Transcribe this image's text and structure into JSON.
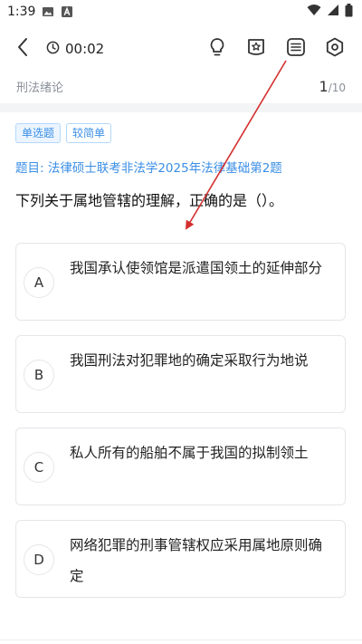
{
  "status_bar": {
    "time": "1:39",
    "icons": [
      "image-icon",
      "a-icon",
      "wifi-icon",
      "signal-icon",
      "battery-icon"
    ]
  },
  "header": {
    "timer": "00:02",
    "icons": [
      "back-arrow-icon",
      "clock-icon",
      "lightbulb-icon",
      "star-badge-icon",
      "list-icon",
      "settings-hexagon-icon"
    ]
  },
  "sub_bar": {
    "chapter": "刑法绪论",
    "current": "1",
    "total": "/10"
  },
  "question": {
    "tags": [
      "单选题",
      "较简单"
    ],
    "source": "题目: 法律硕士联考非法学2025年法律基础第2题",
    "text": "下列关于属地管辖的理解，正确的是（）。",
    "options": [
      {
        "letter": "A",
        "text": "我国承认使领馆是派遣国领土的延伸部分"
      },
      {
        "letter": "B",
        "text": "我国刑法对犯罪地的确定采取行为地说"
      },
      {
        "letter": "C",
        "text": "私人所有的船舶不属于我国的拟制领土"
      },
      {
        "letter": "D",
        "text": "网络犯罪的刑事管辖权应采用属地原则确定"
      }
    ]
  },
  "colors": {
    "accent": "#3a8ee6",
    "annotation_arrow": "#d32f2f"
  }
}
